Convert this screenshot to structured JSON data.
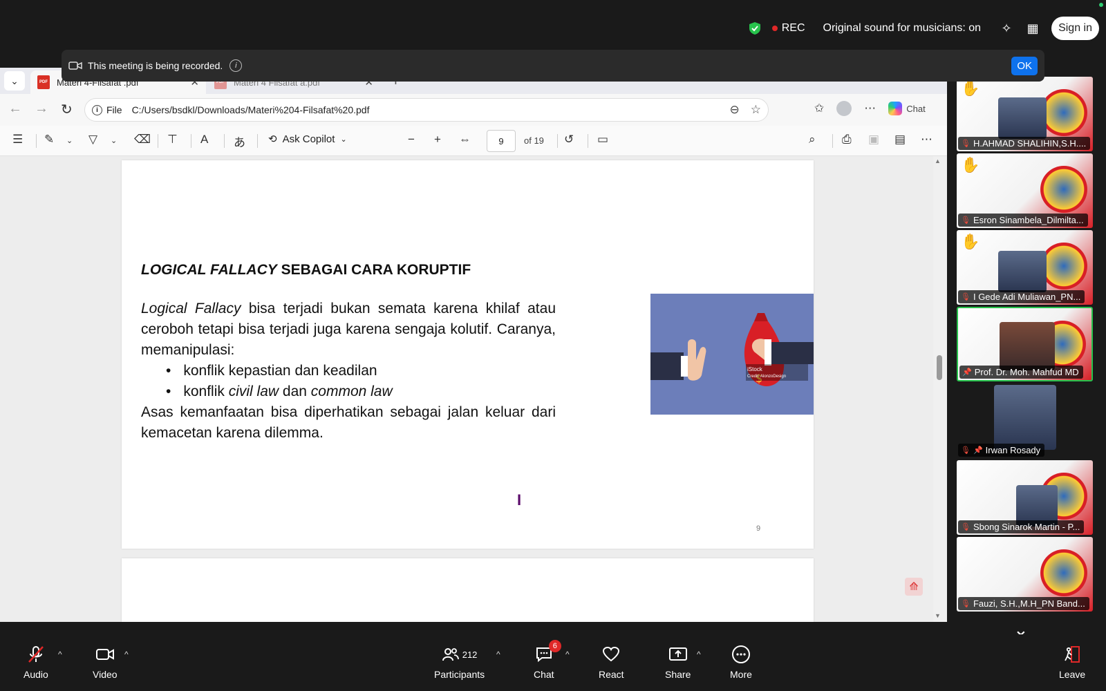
{
  "top": {
    "rec_label": "REC",
    "original_sound": "Original sound for musicians: on",
    "sign_in": "Sign in"
  },
  "banner": {
    "text": "This meeting is being recorded.",
    "info": "i",
    "ok": "OK"
  },
  "browser": {
    "tabs": [
      {
        "label": "Materi 4-Filsafat .pdf",
        "active": true
      },
      {
        "label": "Materi 4 Filsafat a.pdf",
        "active": false
      }
    ],
    "omnibox": {
      "scheme_label": "File",
      "url": "C:/Users/bsdkl/Downloads/Materi%204-Filsafat%20.pdf"
    },
    "chat_label": "Chat"
  },
  "pdf_toolbar": {
    "ask_copilot": "Ask Copilot",
    "page_current": "9",
    "page_total": "of 19"
  },
  "slide": {
    "title_italic": "LOGICAL FALLACY",
    "title_rest": " SEBAGAI CARA KORUPTIF",
    "para1_italic": "Logical Fallacy",
    "para1_rest": " bisa terjadi bukan semata karena khilaf atau ceroboh tetapi bisa terjadi juga karena sengaja kolutif. Caranya, memanipulasi:",
    "bullet1": "konflik kepastian dan keadilan",
    "bullet2_a": "konflik ",
    "bullet2_b": "civil law",
    "bullet2_c": " dan ",
    "bullet2_d": "common law",
    "para2": "Asas kemanfaatan bisa diperhatikan sebagai jalan keluar dari kemacetan karena dilemma.",
    "image_watermark": "iStock",
    "image_credit": "Credit: AlonzoDesign",
    "page_number": "9"
  },
  "gallery": [
    {
      "name": "H.AHMAD SHALIHIN,S.H....",
      "hand": true,
      "pinned": false
    },
    {
      "name": "Esron Sinambela_Dilmilta...",
      "hand": true,
      "pinned": false
    },
    {
      "name": "I Gede Adi Muliawan_PN...",
      "hand": true,
      "pinned": false
    },
    {
      "name": "Prof. Dr. Moh. Mahfud MD",
      "hand": false,
      "pinned": true
    },
    {
      "name": "Irwan Rosady",
      "hand": false,
      "pinned": true
    },
    {
      "name": "Sbong Sinarok Martin - P...",
      "hand": false,
      "pinned": false
    },
    {
      "name": "Fauzi, S.H.,M.H_PN Band...",
      "hand": false,
      "pinned": false
    }
  ],
  "toolbar": {
    "audio": "Audio",
    "video": "Video",
    "participants": "Participants",
    "participants_count": "212",
    "chat": "Chat",
    "chat_badge": "6",
    "react": "React",
    "share": "Share",
    "more": "More",
    "leave": "Leave"
  },
  "colors": {
    "zoom_bg": "#1a1a1a",
    "ok_blue": "#0e72ed",
    "active_speaker": "#27c24c",
    "rec_red": "#e02828"
  }
}
